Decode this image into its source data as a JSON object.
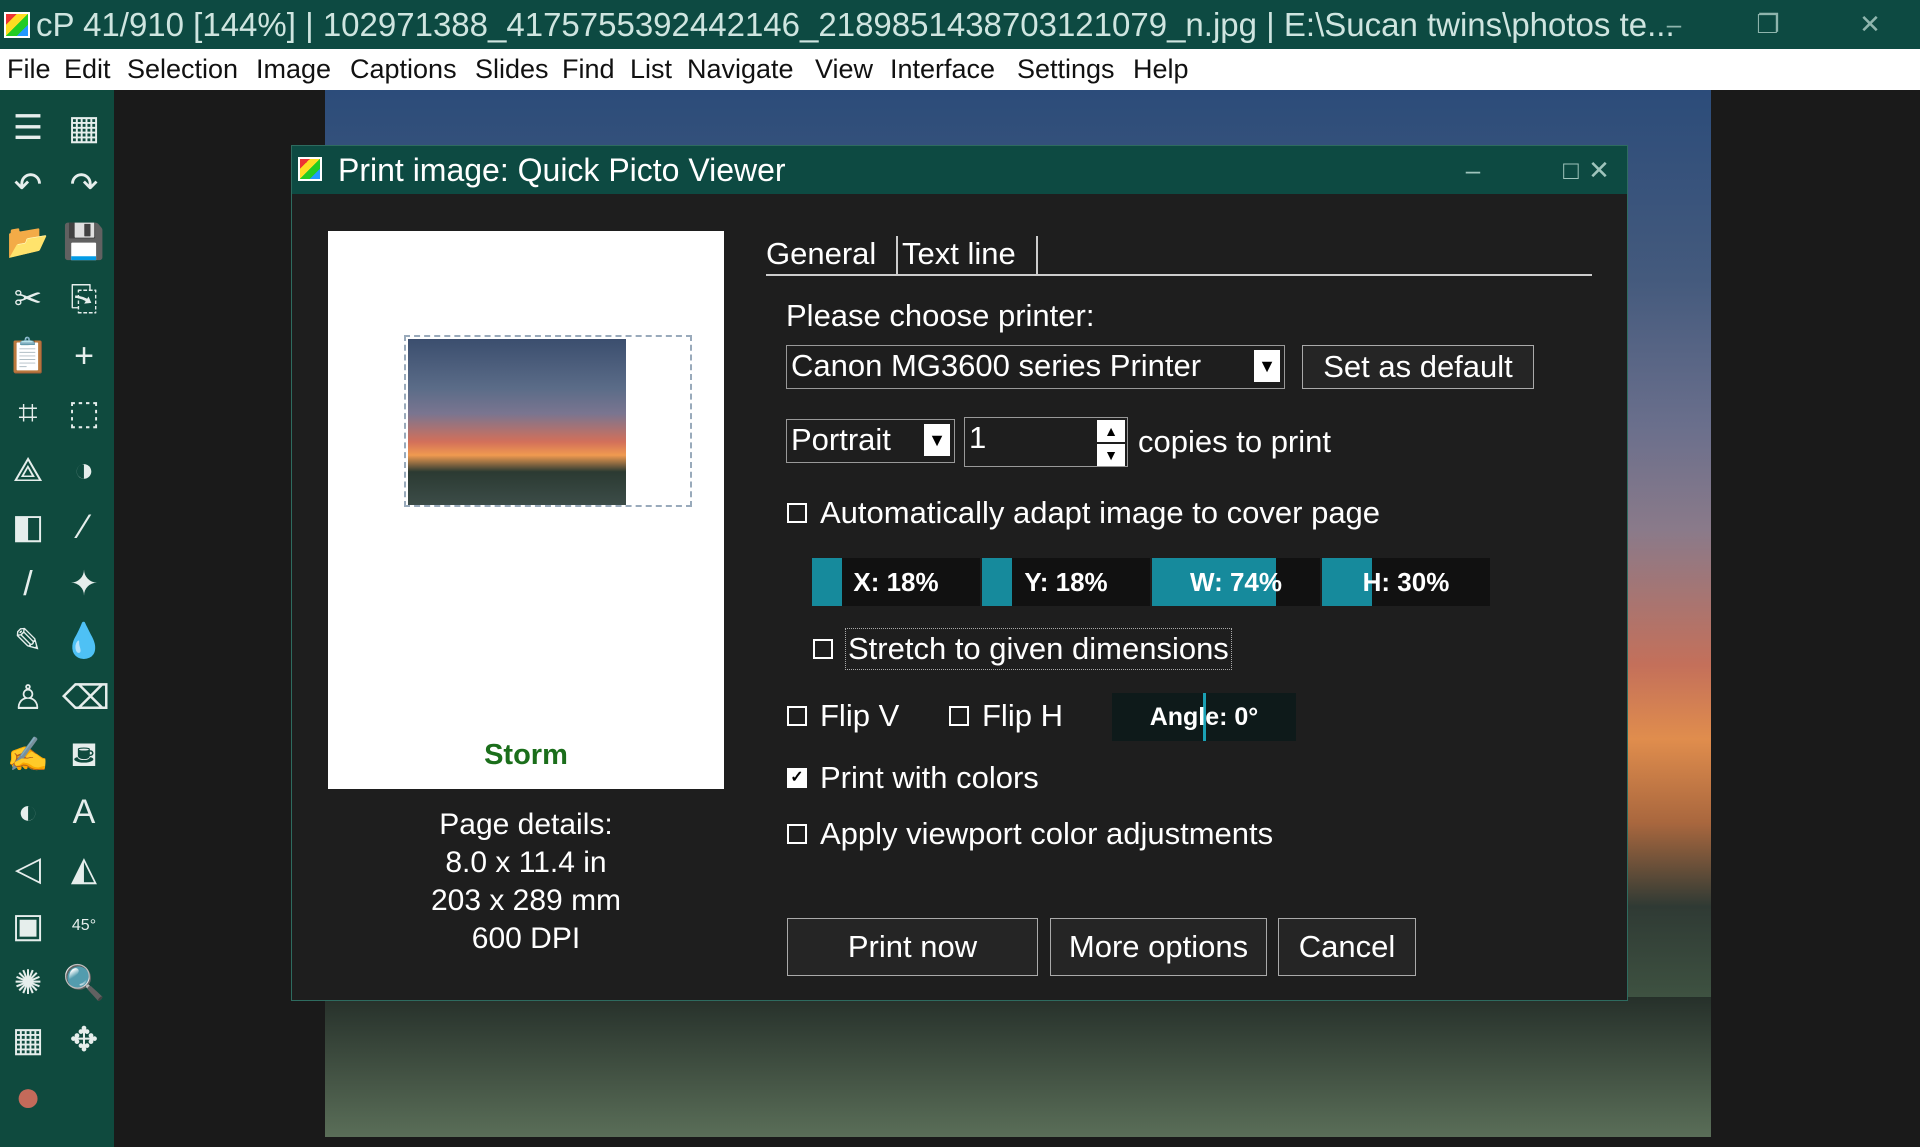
{
  "window": {
    "title": "cP 41/910 [144%] | 102971388_4175755392442146_2189851438703121079_n.jpg | E:\\Sucan twins\\photos te...",
    "controls": {
      "minimize": "–",
      "restore": "❐",
      "close": "✕"
    }
  },
  "menubar": [
    "File",
    "Edit",
    "Selection",
    "Image",
    "Captions",
    "Slides",
    "Find",
    "List",
    "Navigate",
    "View",
    "Interface",
    "Settings",
    "Help"
  ],
  "toolbar": {
    "icons": [
      "menu-list-icon",
      "grid-view-icon",
      "undo-icon",
      "redo-icon",
      "open-folder-icon",
      "save-icon",
      "cut-icon",
      "copy-icon",
      "paste-icon",
      "new-document-icon",
      "crop-icon",
      "select-rect-icon",
      "vector-select-icon",
      "shape-blend-icon",
      "shapes-icon",
      "eyedropper-icon",
      "brush-icon",
      "magic-brush-icon",
      "pen-icon",
      "blur-drop-icon",
      "stamp-icon",
      "eraser-icon",
      "fill-brush-icon",
      "paint-bucket-icon",
      "contrast-icon",
      "text-tool-icon",
      "perspective-icon",
      "flip-icon",
      "image-adjust-icon",
      "rotate-45-icon",
      "color-settings-icon",
      "zoom-icon",
      "grid-icon",
      "move-icon",
      "color-swatch-icon"
    ],
    "glyphs": [
      "☰",
      "▦",
      "↶",
      "↷",
      "📂",
      "💾",
      "✂",
      "⎘",
      "📋",
      "+",
      "⌗",
      "⬚",
      "⟁",
      "◑",
      "◧",
      "⁄",
      "/",
      "✦",
      "✎",
      "💧",
      "♙",
      "⌫",
      "✍",
      "⛾",
      "◐",
      "A",
      "◁",
      "◭",
      "▣",
      "45°",
      "✺",
      "🔍",
      "▦",
      "✥",
      "●"
    ]
  },
  "dialog": {
    "title": "Print image: Quick Picto Viewer",
    "controls": {
      "minimize": "–",
      "maximize": "□",
      "close": "✕"
    },
    "preview": {
      "caption": "Storm"
    },
    "page_details": {
      "label": "Page details:",
      "size_in": "8.0 x 11.4 in",
      "size_mm": "203 x 289 mm",
      "dpi": "600 DPI"
    },
    "tabs": [
      "General",
      "Text line"
    ],
    "printer_label": "Please choose printer:",
    "printer_value": "Canon MG3600 series Printer",
    "set_default_label": "Set as default",
    "orientation_value": "Portrait",
    "copies_value": "1",
    "copies_label": "copies to print",
    "auto_adapt_label": "Automatically adapt image to cover page",
    "auto_adapt_checked": false,
    "sliders": [
      {
        "label": "X: 18%",
        "fraction": 0.18
      },
      {
        "label": "Y: 18%",
        "fraction": 0.18
      },
      {
        "label": "W: 74%",
        "fraction": 0.74
      },
      {
        "label": "H: 30%",
        "fraction": 0.3
      }
    ],
    "stretch_label": "Stretch to given dimensions",
    "stretch_checked": false,
    "flip_v_label": "Flip V",
    "flip_v_checked": false,
    "flip_h_label": "Flip H",
    "flip_h_checked": false,
    "angle_label": "Angle: 0°",
    "angle_fraction": 0.5,
    "print_colors_label": "Print with colors",
    "print_colors_checked": true,
    "viewport_adjust_label": "Apply viewport color adjustments",
    "viewport_adjust_checked": false,
    "buttons": {
      "print_now": "Print now",
      "more_options": "More options",
      "cancel": "Cancel"
    }
  }
}
